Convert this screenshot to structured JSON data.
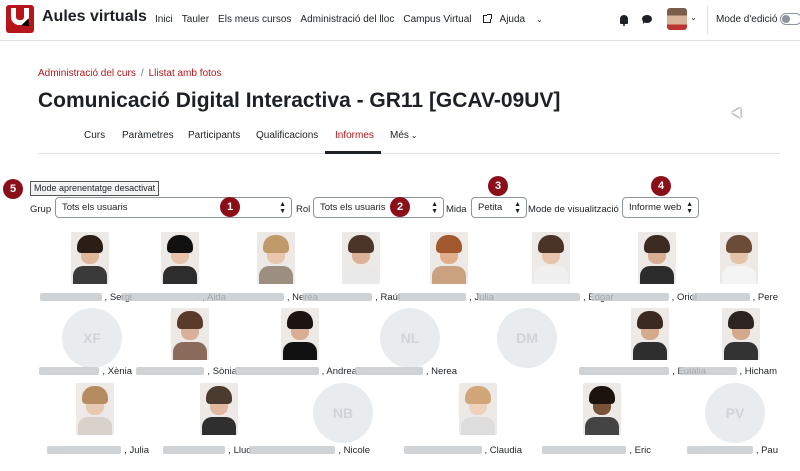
{
  "navbar": {
    "brand": "Aules virtuals",
    "links": [
      "Inici",
      "Tauler",
      "Els meus cursos",
      "Administració del lloc",
      "Campus Virtual",
      "Ajuda"
    ],
    "edit_mode_label": "Mode d'edició"
  },
  "breadcrumb": {
    "item1": "Administració del curs",
    "item2": "Llistat amb fotos"
  },
  "page_title": "Comunicació Digital Interactiva - GR11 [GCAV-09UV]",
  "tabs": [
    "Curs",
    "Paràmetres",
    "Participants",
    "Qualificacions",
    "Informes",
    "Més"
  ],
  "active_tab": "Informes",
  "filters": {
    "mode_button": "Mode aprenentatge desactivat",
    "group_label": "Grup",
    "group_value": "Tots els usuaris",
    "role_label": "Rol",
    "role_value": "Tots els usuaris",
    "size_label": "Mida",
    "size_value": "Petita",
    "view_label": "Mode de visualització",
    "view_value": "Informe web"
  },
  "badges": [
    "1",
    "2",
    "3",
    "4",
    "5"
  ],
  "people": [
    {
      "name": "Sergi",
      "initials": ""
    },
    {
      "name": "Aida",
      "initials": ""
    },
    {
      "name": "Nerea",
      "initials": ""
    },
    {
      "name": "Raúl",
      "initials": ""
    },
    {
      "name": "Julia",
      "initials": ""
    },
    {
      "name": "Edgar",
      "initials": ""
    },
    {
      "name": "Oriol",
      "initials": ""
    },
    {
      "name": "Pere",
      "initials": ""
    },
    {
      "name": "Xènia",
      "initials": "XF"
    },
    {
      "name": "Sònia",
      "initials": ""
    },
    {
      "name": "Andrea",
      "initials": ""
    },
    {
      "name": "Nerea",
      "initials": "NL"
    },
    {
      "name": "",
      "initials": "DM"
    },
    {
      "name": "Eulàlia",
      "initials": ""
    },
    {
      "name": "Hicham",
      "initials": ""
    },
    {
      "name": "Julia",
      "initials": ""
    },
    {
      "name": "Lluc",
      "initials": ""
    },
    {
      "name": "Nicole",
      "initials": "NB"
    },
    {
      "name": "Claudia",
      "initials": ""
    },
    {
      "name": "Eric",
      "initials": ""
    },
    {
      "name": "Pau",
      "initials": "PV"
    }
  ],
  "colors": {
    "brand_red": "#b5151b",
    "badge_red": "#8b0f18"
  }
}
